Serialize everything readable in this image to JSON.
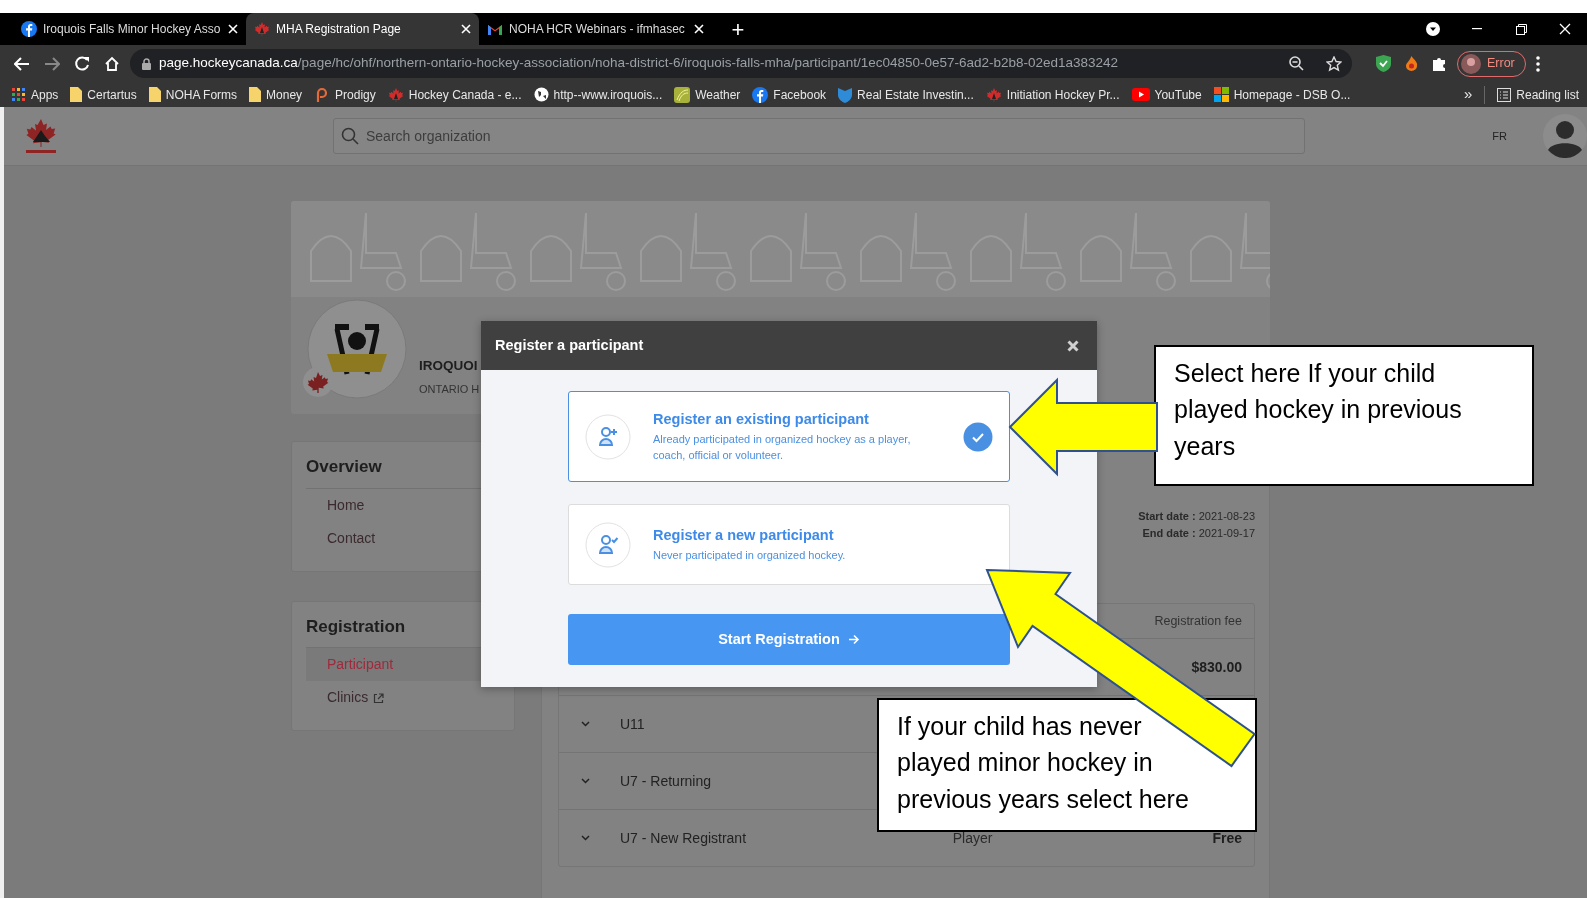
{
  "browser": {
    "tabs": [
      {
        "title": "Iroquois Falls Minor Hockey Asso",
        "kind": "facebook",
        "selected": false
      },
      {
        "title": "MHA Registration Page",
        "kind": "hockey",
        "selected": true
      },
      {
        "title": "NOHA HCR Webinars - ifmhasec",
        "kind": "gmail",
        "selected": false
      }
    ],
    "new_tab": "+",
    "url_host": "page.hockeycanada.ca",
    "url_path": "/page/hc/ohf/northern-ontario-hockey-association/noha-district-6/iroquois-falls-mha/participant/1ec04850-0e57-6ad2-b2b8-02ed1a383242",
    "profile_label": "Error",
    "bookmarks": [
      {
        "label": "Apps",
        "kind": "apps"
      },
      {
        "label": "Certartus",
        "kind": "folder"
      },
      {
        "label": "NOHA Forms",
        "kind": "folder"
      },
      {
        "label": "Money",
        "kind": "folder"
      },
      {
        "label": "Prodigy",
        "kind": "prodigy"
      },
      {
        "label": "Hockey Canada - e...",
        "kind": "hockey"
      },
      {
        "label": "http--www.iroquois...",
        "kind": "globe"
      },
      {
        "label": "Weather",
        "kind": "weather"
      },
      {
        "label": "Facebook",
        "kind": "facebook"
      },
      {
        "label": "Real Estate Investin...",
        "kind": "shield"
      },
      {
        "label": "Initiation Hockey Pr...",
        "kind": "hockey"
      },
      {
        "label": "YouTube",
        "kind": "youtube"
      },
      {
        "label": "Homepage - DSB O...",
        "kind": "windows"
      }
    ],
    "overflow": "»",
    "reading_list": "Reading list"
  },
  "header": {
    "search": {
      "placeholder": "Search organization"
    },
    "language": "FR"
  },
  "organization": {
    "name": "IROQUOI",
    "subtitle": "ONTARIO H"
  },
  "sidebar": [
    {
      "title": "Overview",
      "items": [
        {
          "label": "Home",
          "selected": false,
          "external": false
        },
        {
          "label": "Contact",
          "selected": false,
          "external": false
        }
      ]
    },
    {
      "title": "Registration",
      "items": [
        {
          "label": "Participant",
          "selected": true,
          "external": false
        },
        {
          "label": "Clinics",
          "selected": false,
          "external": true
        }
      ]
    }
  ],
  "season": {
    "start_label": "Start date :",
    "start": "2021-08-23",
    "end_label": "End date :",
    "end": "2021-09-17"
  },
  "fees": {
    "header": "Registration fee",
    "rows": [
      {
        "fee": "$830.00"
      },
      {
        "name": "U11"
      },
      {
        "name": "U7 - Returning"
      },
      {
        "name": "U7 - New Registrant",
        "role": "Player",
        "fee": "Free"
      }
    ]
  },
  "modal": {
    "title": "Register a participant",
    "options": [
      {
        "kind": "existing",
        "title": "Register an existing participant",
        "description": "Already participated in organized hockey as a player, coach, official or volunteer.",
        "selected": true
      },
      {
        "kind": "new",
        "title": "Register a new participant",
        "description": "Never participated in organized hockey.",
        "selected": false
      }
    ],
    "button": "Start Registration"
  },
  "annotations": [
    {
      "text": "Select here If your child played hockey in previous years"
    },
    {
      "text": "If your child has never played minor hockey in previous years select here"
    }
  ]
}
